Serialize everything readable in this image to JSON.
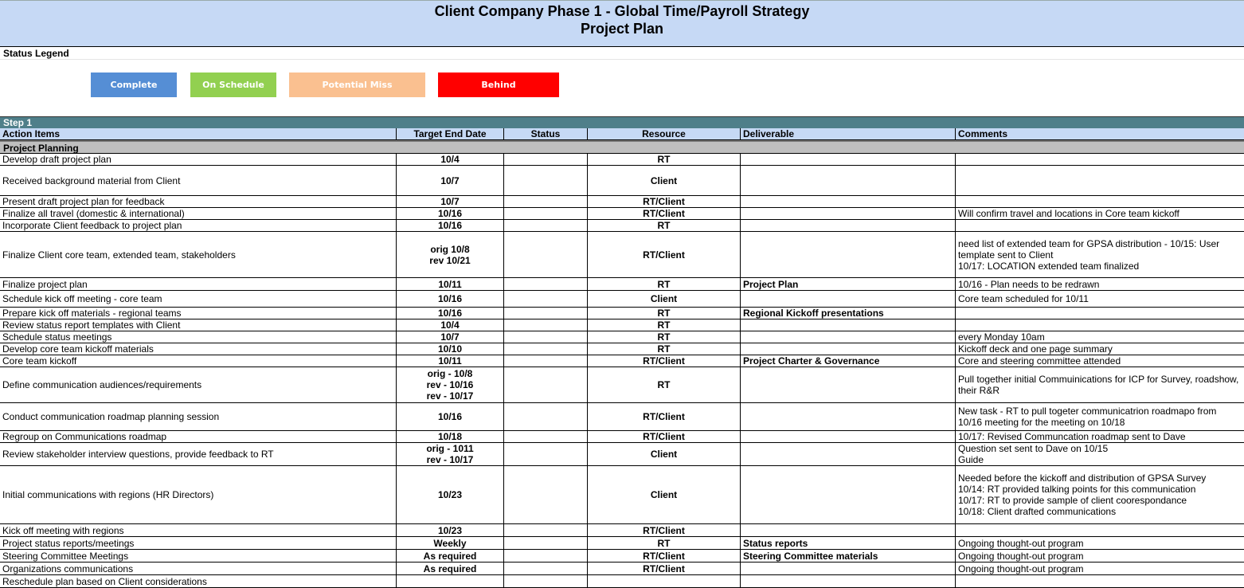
{
  "header": {
    "title": "Client Company Phase 1 - Global Time/Payroll Strategy",
    "subtitle": "Project Plan"
  },
  "legend": {
    "title": "Status Legend",
    "items": [
      {
        "label": "Complete",
        "color": "#558ed5"
      },
      {
        "label": "On Schedule",
        "color": "#92d050"
      },
      {
        "label": "Potential Miss",
        "color": "#fac090"
      },
      {
        "label": "Behind",
        "color": "#ff0000"
      }
    ]
  },
  "table": {
    "step": "Step 1",
    "columns": [
      "Action Items",
      "Target End Date",
      "Status",
      "Resource",
      "Deliverable",
      "Comments"
    ],
    "section": "Project Planning",
    "rows": [
      {
        "action": "Develop draft project plan",
        "target": [
          "10/4"
        ],
        "resource": "RT",
        "deliverable": "",
        "comments": []
      },
      {
        "action": "Received background material from Client",
        "target": [
          "10/7"
        ],
        "resource": "Client",
        "deliverable": "",
        "comments": []
      },
      {
        "action": "Present draft project plan for feedback",
        "target": [
          "10/7"
        ],
        "resource": "RT/Client",
        "deliverable": "",
        "comments": []
      },
      {
        "action": "Finalize all travel (domestic & international)",
        "target": [
          "10/16"
        ],
        "resource": "RT/Client",
        "deliverable": "",
        "comments": [
          "Will confirm travel and locations in Core team kickoff"
        ]
      },
      {
        "action": "Incorporate Client feedback to project plan",
        "target": [
          "10/16"
        ],
        "resource": "RT",
        "deliverable": "",
        "comments": []
      },
      {
        "action": "Finalize Client core team, extended team, stakeholders",
        "target": [
          "orig 10/8",
          "rev 10/21"
        ],
        "resource": "RT/Client",
        "deliverable": "",
        "comments": [
          "need list of extended team  for GPSA distribution - 10/15: User template sent to Client",
          "10/17: LOCATION extended team finalized"
        ]
      },
      {
        "action": "Finalize project plan",
        "target": [
          "10/11"
        ],
        "resource": "RT",
        "deliverable": "Project Plan",
        "comments": [
          "10/16 - Plan needs to be redrawn"
        ]
      },
      {
        "action": "Schedule kick off meeting - core team",
        "target": [
          "10/16"
        ],
        "resource": "Client",
        "deliverable": "",
        "comments": [
          "Core team scheduled for 10/11"
        ]
      },
      {
        "action": "Prepare kick off materials - regional teams",
        "target": [
          "10/16"
        ],
        "resource": "RT",
        "deliverable": "Regional Kickoff presentations",
        "comments": []
      },
      {
        "action": "Review status report templates with Client",
        "target": [
          "10/4"
        ],
        "resource": "RT",
        "deliverable": "",
        "comments": []
      },
      {
        "action": "Schedule status meetings",
        "target": [
          "10/7"
        ],
        "resource": "RT",
        "deliverable": "",
        "comments": [
          "every Monday 10am"
        ]
      },
      {
        "action": "Develop core team kickoff materials",
        "target": [
          "10/10"
        ],
        "resource": "RT",
        "deliverable": "",
        "comments": [
          "Kickoff deck and one page summary"
        ]
      },
      {
        "action": "Core team kickoff",
        "target": [
          "10/11"
        ],
        "resource": "RT/Client",
        "deliverable": "Project Charter & Governance",
        "comments": [
          "Core and steering committee attended"
        ]
      },
      {
        "action": "Define communication audiences/requirements",
        "target": [
          "orig - 10/8",
          "rev - 10/16",
          "rev - 10/17"
        ],
        "resource": "RT",
        "deliverable": "",
        "comments": [
          "Pull together initial Commuinications for ICP for Survey, roadshow, their R&R"
        ]
      },
      {
        "action": "Conduct communication roadmap planning session",
        "target": [
          "10/16"
        ],
        "resource": "RT/Client",
        "deliverable": "",
        "comments": [
          "New task - RT to pull togeter communicatrion roadmapo from 10/16 meeting for the meeting on 10/18"
        ]
      },
      {
        "action": "Regroup on Communications roadmap",
        "target": [
          "10/18"
        ],
        "resource": "RT/Client",
        "deliverable": "",
        "comments": [
          "10/17: Revised Communcation roadmap sent to Dave"
        ]
      },
      {
        "action": "Review stakeholder interview questions, provide feedback to RT",
        "target": [
          "orig - 1011",
          "rev - 10/17"
        ],
        "resource": "Client",
        "deliverable": "",
        "comments": [
          "Question set sent to Dave on 10/15",
          "Guide"
        ]
      },
      {
        "action": "Initial communications with regions (HR Directors)",
        "target": [
          "10/23"
        ],
        "resource": "Client",
        "deliverable": "",
        "comments": [
          "Needed before the kickoff and distribution of GPSA Survey",
          "10/14: RT provided talking points for this communication",
          "10/17: RT to provide sample of client coorespondance",
          "10/18: Client drafted communications"
        ]
      },
      {
        "action": "Kick off meeting with regions",
        "target": [
          "10/23"
        ],
        "resource": "RT/Client",
        "deliverable": "",
        "comments": []
      },
      {
        "action": "Project status reports/meetings",
        "target": [
          "Weekly"
        ],
        "resource": "RT",
        "deliverable": "Status reports",
        "comments": [
          "Ongoing thought-out program"
        ]
      },
      {
        "action": "Steering Committee Meetings",
        "target": [
          "As required"
        ],
        "resource": "RT/Client",
        "deliverable": "Steering Committee materials",
        "comments": [
          "Ongoing thought-out program"
        ]
      },
      {
        "action": "Organizations communications",
        "target": [
          "As required"
        ],
        "resource": "RT/Client",
        "deliverable": "",
        "comments": [
          "Ongoing thought-out program"
        ]
      },
      {
        "action": "Reschedule plan based on Client considerations",
        "target": [],
        "resource": "",
        "deliverable": "",
        "comments": []
      }
    ]
  }
}
